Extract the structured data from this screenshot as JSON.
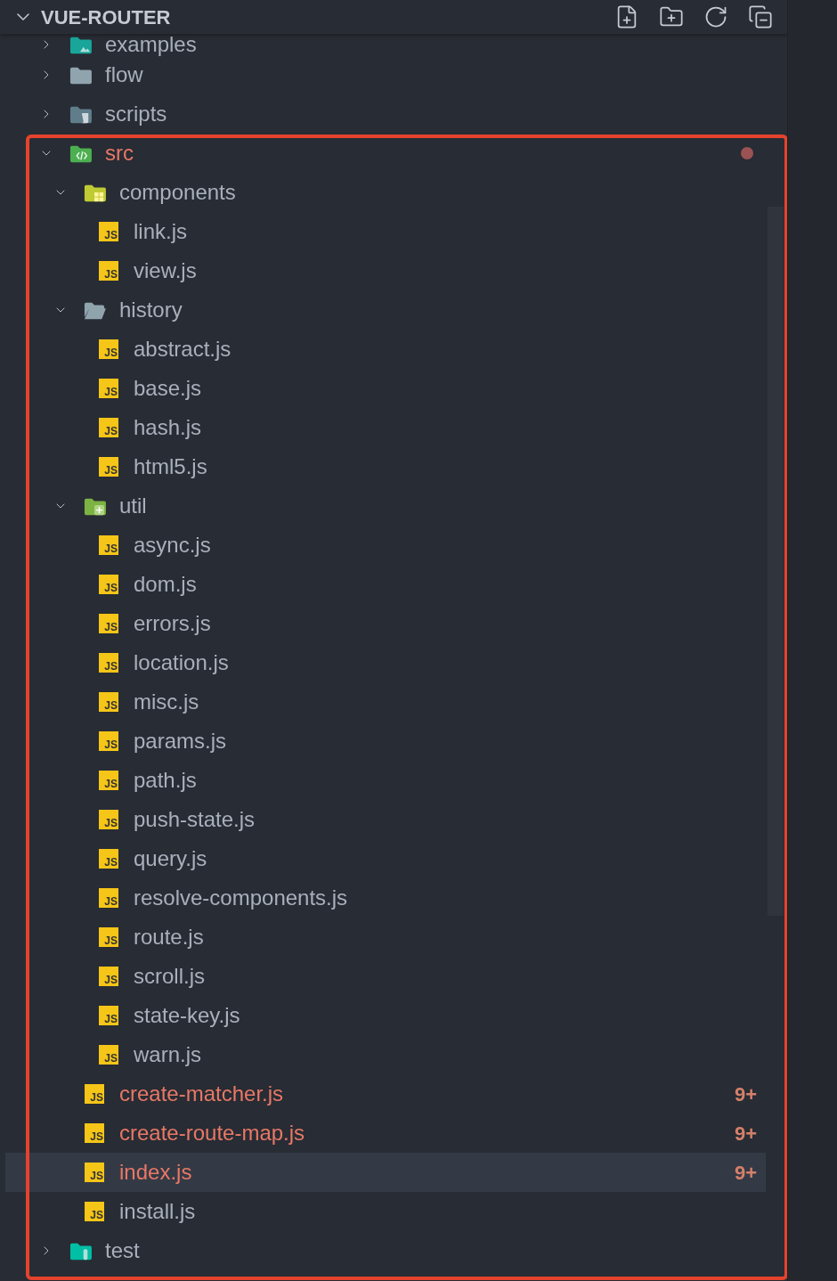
{
  "header": {
    "title": "VUE-ROUTER",
    "expanded": true
  },
  "tree": [
    {
      "name": "examples",
      "kind": "folder-image",
      "expanded": false,
      "modified": false,
      "selected": false
    },
    {
      "name": "flow",
      "kind": "folder-plain",
      "expanded": false,
      "modified": false,
      "selected": false
    },
    {
      "name": "scripts",
      "kind": "folder-script",
      "expanded": false,
      "modified": false,
      "selected": false
    },
    {
      "name": "src",
      "kind": "folder-code",
      "expanded": true,
      "modified": true,
      "selected": false,
      "children": [
        {
          "name": "components",
          "kind": "folder-components",
          "expanded": true,
          "modified": false,
          "selected": false,
          "children": [
            {
              "name": "link.js",
              "kind": "js-file",
              "badge": "JS",
              "modified": false,
              "selected": false
            },
            {
              "name": "view.js",
              "kind": "js-file",
              "badge": "JS",
              "modified": false,
              "selected": false
            }
          ]
        },
        {
          "name": "history",
          "kind": "folder-open",
          "expanded": true,
          "modified": false,
          "selected": false,
          "children": [
            {
              "name": "abstract.js",
              "kind": "js-file",
              "badge": "JS",
              "modified": false,
              "selected": false
            },
            {
              "name": "base.js",
              "kind": "js-file",
              "badge": "JS",
              "modified": false,
              "selected": false
            },
            {
              "name": "hash.js",
              "kind": "js-file",
              "badge": "JS",
              "modified": false,
              "selected": false
            },
            {
              "name": "html5.js",
              "kind": "js-file",
              "badge": "JS",
              "modified": false,
              "selected": false
            }
          ]
        },
        {
          "name": "util",
          "kind": "folder-util",
          "expanded": true,
          "modified": false,
          "selected": false,
          "children": [
            {
              "name": "async.js",
              "kind": "js-file",
              "badge": "JS",
              "modified": false,
              "selected": false
            },
            {
              "name": "dom.js",
              "kind": "js-file",
              "badge": "JS",
              "modified": false,
              "selected": false
            },
            {
              "name": "errors.js",
              "kind": "js-file",
              "badge": "JS",
              "modified": false,
              "selected": false
            },
            {
              "name": "location.js",
              "kind": "js-file",
              "badge": "JS",
              "modified": false,
              "selected": false
            },
            {
              "name": "misc.js",
              "kind": "js-file",
              "badge": "JS",
              "modified": false,
              "selected": false
            },
            {
              "name": "params.js",
              "kind": "js-file",
              "badge": "JS",
              "modified": false,
              "selected": false
            },
            {
              "name": "path.js",
              "kind": "js-file",
              "badge": "JS",
              "modified": false,
              "selected": false
            },
            {
              "name": "push-state.js",
              "kind": "js-file",
              "badge": "JS",
              "modified": false,
              "selected": false
            },
            {
              "name": "query.js",
              "kind": "js-file",
              "badge": "JS",
              "modified": false,
              "selected": false
            },
            {
              "name": "resolve-components.js",
              "kind": "js-file",
              "badge": "JS",
              "modified": false,
              "selected": false
            },
            {
              "name": "route.js",
              "kind": "js-file",
              "badge": "JS",
              "modified": false,
              "selected": false
            },
            {
              "name": "scroll.js",
              "kind": "js-file",
              "badge": "JS",
              "modified": false,
              "selected": false
            },
            {
              "name": "state-key.js",
              "kind": "js-file",
              "badge": "JS",
              "modified": false,
              "selected": false
            },
            {
              "name": "warn.js",
              "kind": "js-file",
              "badge": "JS",
              "modified": false,
              "selected": false
            }
          ]
        },
        {
          "name": "create-matcher.js",
          "kind": "js-file",
          "badge": "JS",
          "modified": true,
          "count": "9+",
          "selected": false
        },
        {
          "name": "create-route-map.js",
          "kind": "js-file",
          "badge": "JS",
          "modified": true,
          "count": "9+",
          "selected": false
        },
        {
          "name": "index.js",
          "kind": "js-file",
          "badge": "JS",
          "modified": true,
          "count": "9+",
          "selected": true
        },
        {
          "name": "install.js",
          "kind": "js-file",
          "badge": "JS",
          "modified": false,
          "selected": false
        }
      ]
    },
    {
      "name": "test",
      "kind": "folder-test",
      "expanded": false,
      "modified": false,
      "selected": false
    }
  ]
}
